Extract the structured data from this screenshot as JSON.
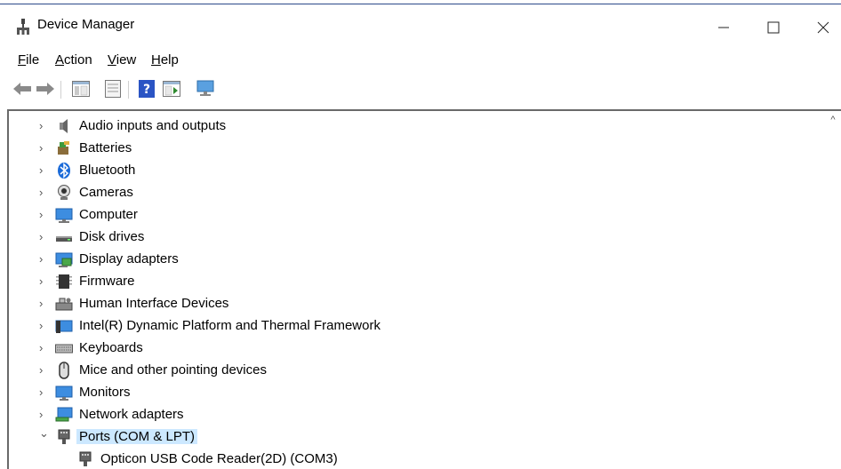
{
  "window": {
    "title": "Device Manager",
    "minimize_glyph": "—",
    "close_glyph": "✕"
  },
  "menu": {
    "items": [
      {
        "label": "File"
      },
      {
        "label": "Action"
      },
      {
        "label": "View"
      },
      {
        "label": "Help"
      }
    ]
  },
  "toolbar": {
    "buttons": [
      "back-arrow-icon",
      "forward-arrow-icon",
      "show-hide-console-tree-icon",
      "properties-icon",
      "help-icon",
      "update-driver-icon",
      "scan-hardware-icon"
    ]
  },
  "tree": {
    "nodes": [
      {
        "label": "Audio inputs and outputs",
        "icon": "speaker-icon",
        "expanded": false
      },
      {
        "label": "Batteries",
        "icon": "battery-icon",
        "expanded": false
      },
      {
        "label": "Bluetooth",
        "icon": "bluetooth-icon",
        "expanded": false
      },
      {
        "label": "Cameras",
        "icon": "camera-icon",
        "expanded": false
      },
      {
        "label": "Computer",
        "icon": "computer-icon",
        "expanded": false
      },
      {
        "label": "Disk drives",
        "icon": "disk-drive-icon",
        "expanded": false
      },
      {
        "label": "Display adapters",
        "icon": "display-adapter-icon",
        "expanded": false
      },
      {
        "label": "Firmware",
        "icon": "firmware-icon",
        "expanded": false
      },
      {
        "label": "Human Interface Devices",
        "icon": "hid-icon",
        "expanded": false
      },
      {
        "label": "Intel(R) Dynamic Platform and Thermal Framework",
        "icon": "intel-framework-icon",
        "expanded": false
      },
      {
        "label": "Keyboards",
        "icon": "keyboard-icon",
        "expanded": false
      },
      {
        "label": "Mice and other pointing devices",
        "icon": "mouse-icon",
        "expanded": false
      },
      {
        "label": "Monitors",
        "icon": "monitor-icon",
        "expanded": false
      },
      {
        "label": "Network adapters",
        "icon": "network-adapter-icon",
        "expanded": false
      },
      {
        "label": "Ports (COM & LPT)",
        "icon": "port-icon",
        "expanded": true,
        "selected": true
      },
      {
        "label": "Opticon USB Code Reader(2D) (COM3)",
        "icon": "port-device-icon",
        "child": true
      }
    ]
  },
  "glyphs": {
    "collapsed": "›",
    "expanded": "⌄",
    "scroll_up": "^"
  }
}
